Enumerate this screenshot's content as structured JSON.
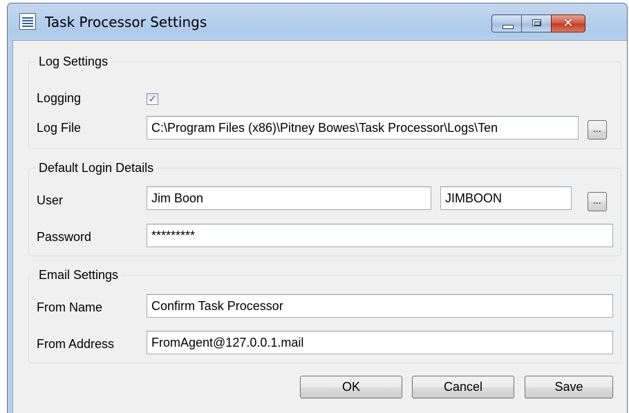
{
  "window": {
    "title": "Task Processor Settings",
    "icon": "document-list-icon",
    "controls": {
      "minimize": "minimize-icon",
      "maximize": "maximize-icon",
      "close_glyph": "✕"
    }
  },
  "log_settings": {
    "legend": "Log Settings",
    "logging_label": "Logging",
    "logging_checked": true,
    "checkmark": "✓",
    "log_file_label": "Log File",
    "log_file_value": "C:\\Program Files (x86)\\Pitney Bowes\\Task Processor\\Logs\\Ten",
    "browse_label": "..."
  },
  "login": {
    "legend": "Default Login Details",
    "user_label": "User",
    "user_name": "Jim Boon",
    "user_id": "JIMBOON",
    "browse_label": "...",
    "password_label": "Password",
    "password_value": "*********"
  },
  "email": {
    "legend": "Email Settings",
    "from_name_label": "From Name",
    "from_name_value": "Confirm Task Processor",
    "from_address_label": "From Address",
    "from_address_value": "FromAgent@127.0.0.1.mail"
  },
  "buttons": {
    "ok": "OK",
    "cancel": "Cancel",
    "save": "Save"
  }
}
